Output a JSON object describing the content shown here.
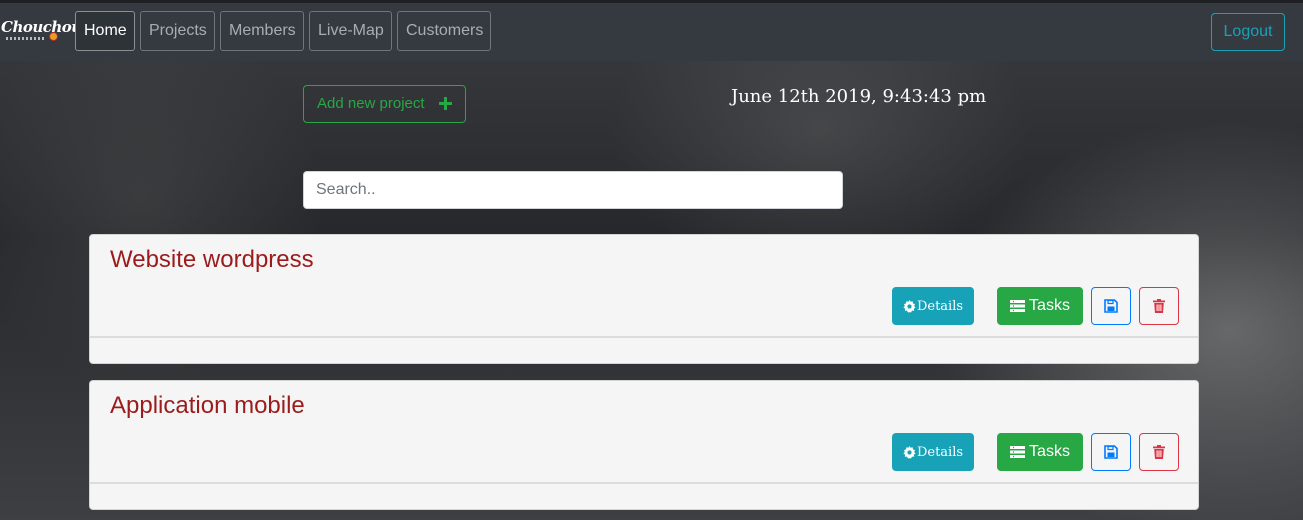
{
  "app": {
    "logo": "Chouchou"
  },
  "nav": {
    "items": [
      {
        "label": "Home",
        "active": true
      },
      {
        "label": "Projects",
        "active": false
      },
      {
        "label": "Members",
        "active": false
      },
      {
        "label": "Live-Map",
        "active": false
      },
      {
        "label": "Customers",
        "active": false
      }
    ],
    "logout_label": "Logout"
  },
  "toolbar": {
    "add_project_label": "Add new project",
    "datetime": "June 12th 2019, 9:43:43 pm",
    "search_placeholder": "Search.."
  },
  "projects": [
    {
      "title": "Website wordpress",
      "details_label": "Details",
      "tasks_label": "Tasks"
    },
    {
      "title": "Application mobile",
      "details_label": "Details",
      "tasks_label": "Tasks"
    }
  ],
  "colors": {
    "navbar": "#343a40",
    "info": "#17a2b8",
    "success": "#28a745",
    "primary": "#007bff",
    "danger": "#dc3545",
    "project_title": "#9b1c1c"
  },
  "icons": {
    "add": "plus-icon",
    "details": "gear-icon",
    "tasks": "list-icon",
    "save": "save-icon",
    "delete": "trash-icon"
  }
}
